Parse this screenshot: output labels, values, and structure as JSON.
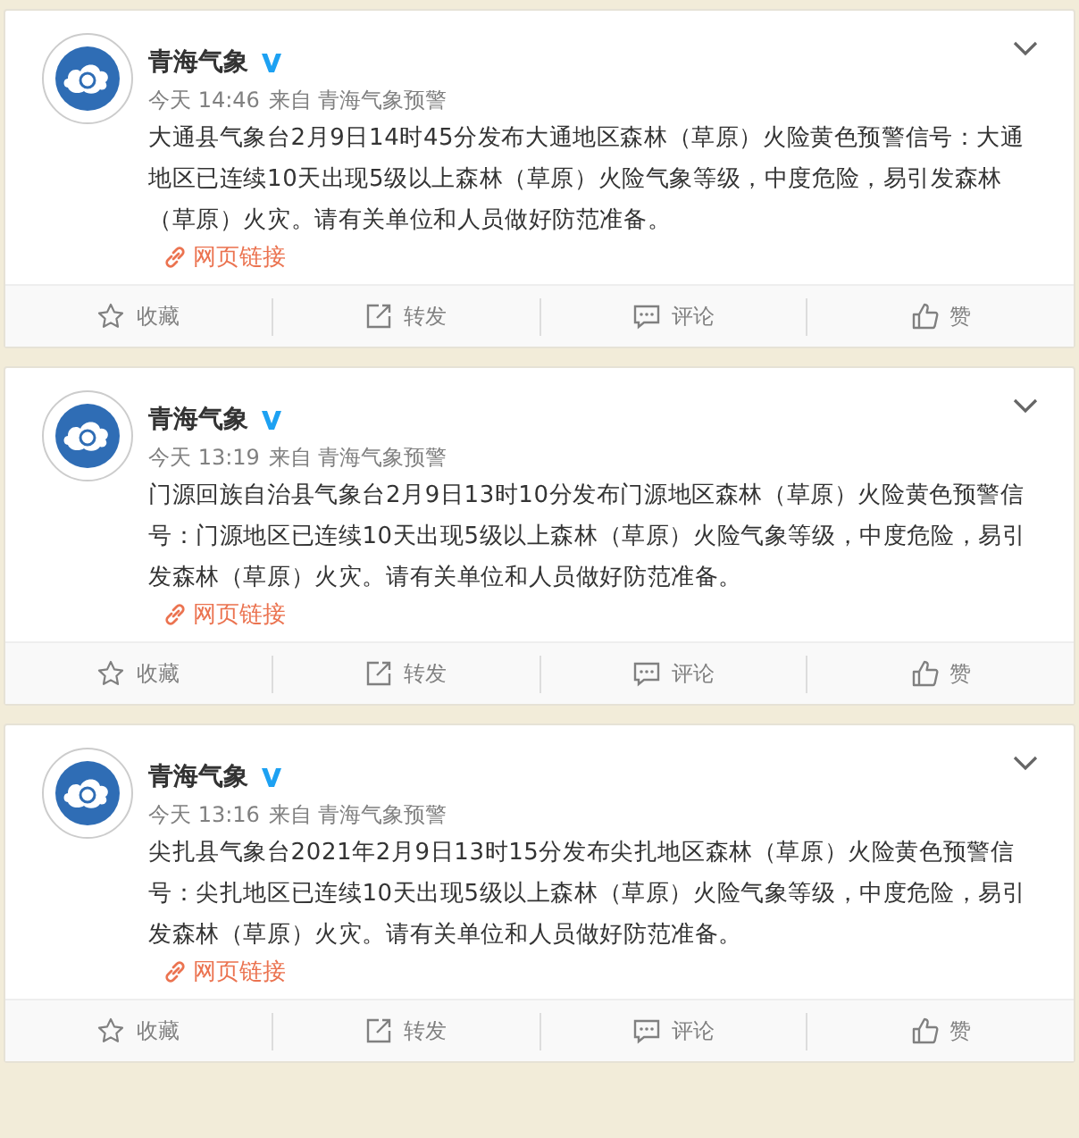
{
  "posts": [
    {
      "author": "青海气象",
      "verified": true,
      "time": "今天 14:46",
      "source": "来自 青海气象预警",
      "text": "大通县气象台2月9日14时45分发布大通地区森林（草原）火险黄色预警信号：大通地区已连续10天出现5级以上森林（草原）火险气象等级，中度危险，易引发森林（草原）火灾。请有关单位和人员做好防范准备。",
      "link": "网页链接",
      "actions": [
        {
          "kind": "favorite",
          "label": "收藏"
        },
        {
          "kind": "repost",
          "label": "转发"
        },
        {
          "kind": "comment",
          "label": "评论"
        },
        {
          "kind": "like",
          "label": "赞"
        }
      ]
    },
    {
      "author": "青海气象",
      "verified": true,
      "time": "今天 13:19",
      "source": "来自 青海气象预警",
      "text": "门源回族自治县气象台2月9日13时10分发布门源地区森林（草原）火险黄色预警信号：门源地区已连续10天出现5级以上森林（草原）火险气象等级，中度危险，易引发森林（草原）火灾。请有关单位和人员做好防范准备。",
      "link": "网页链接",
      "actions": [
        {
          "kind": "favorite",
          "label": "收藏"
        },
        {
          "kind": "repost",
          "label": "转发"
        },
        {
          "kind": "comment",
          "label": "评论"
        },
        {
          "kind": "like",
          "label": "赞"
        }
      ]
    },
    {
      "author": "青海气象",
      "verified": true,
      "time": "今天 13:16",
      "source": "来自 青海气象预警",
      "text": "尖扎县气象台2021年2月9日13时15分发布尖扎地区森林（草原）火险黄色预警信号：尖扎地区已连续10天出现5级以上森林（草原）火险气象等级，中度危险，易引发森林（草原）火灾。请有关单位和人员做好防范准备。",
      "link": "网页链接",
      "actions": [
        {
          "kind": "favorite",
          "label": "收藏"
        },
        {
          "kind": "repost",
          "label": "转发"
        },
        {
          "kind": "comment",
          "label": "评论"
        },
        {
          "kind": "like",
          "label": "赞"
        }
      ]
    }
  ]
}
